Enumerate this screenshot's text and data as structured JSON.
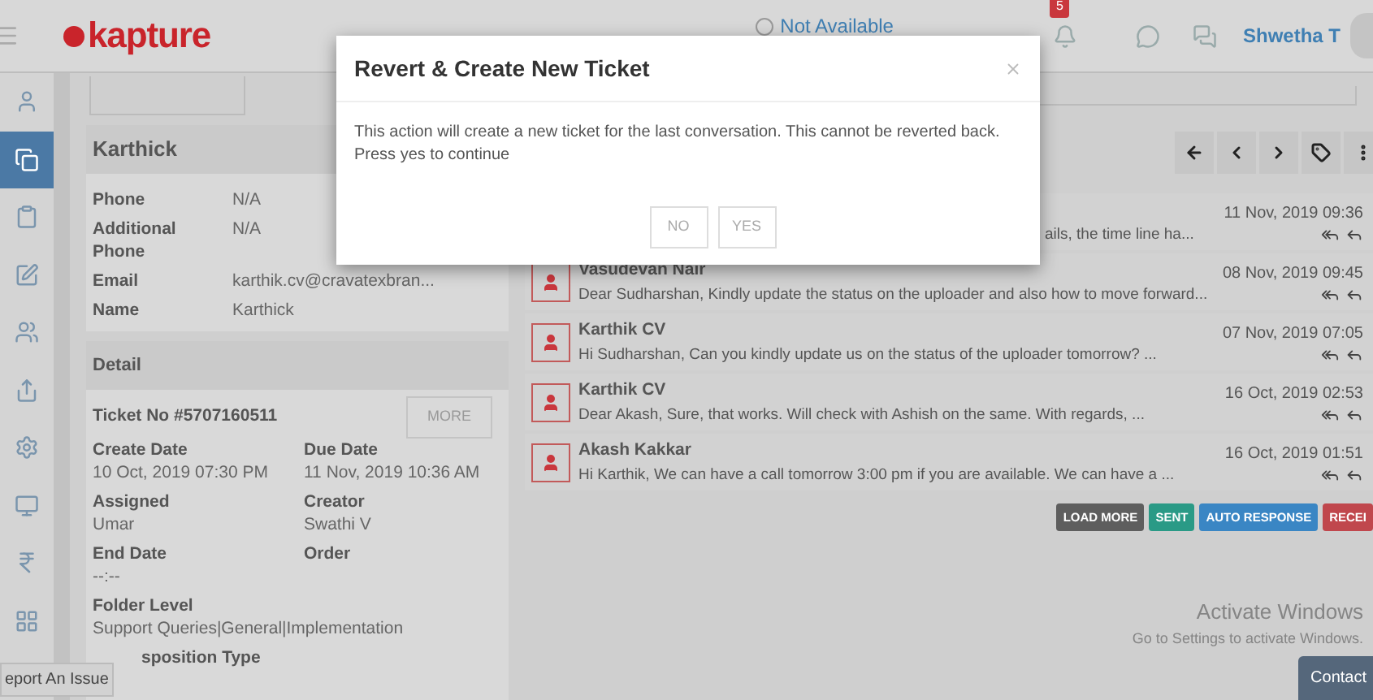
{
  "header": {
    "logo": "kapture",
    "status": {
      "label": "Not Available",
      "on": false
    },
    "notifications": {
      "count": "5"
    },
    "user": "Shwetha T"
  },
  "sidebar": {
    "items": [
      {
        "kind": "person",
        "selected": false
      },
      {
        "kind": "documents",
        "selected": true
      },
      {
        "kind": "clipboard",
        "selected": false
      },
      {
        "kind": "edit",
        "selected": false
      },
      {
        "kind": "contacts",
        "selected": false
      },
      {
        "kind": "share",
        "selected": false
      },
      {
        "kind": "settings",
        "selected": false
      },
      {
        "kind": "monitor",
        "selected": false
      },
      {
        "kind": "rupee",
        "selected": false
      },
      {
        "kind": "grid",
        "selected": false
      }
    ]
  },
  "customer": {
    "name": "Karthick",
    "fields": [
      {
        "label": "Phone",
        "value": "N/A"
      },
      {
        "label": "Additional Phone",
        "value": "N/A"
      },
      {
        "label": "Email",
        "value": "karthik.cv@cravatexbran..."
      },
      {
        "label": "Name",
        "value": "Karthick"
      }
    ]
  },
  "detail": {
    "title": "Detail",
    "ticket": "Ticket No #5707160511",
    "more": "MORE",
    "fields": [
      {
        "label": "Create Date",
        "value": "10 Oct, 2019 07:30 PM"
      },
      {
        "label": "Due Date",
        "value": "11 Nov, 2019 10:36 AM"
      },
      {
        "label": "Assigned",
        "value": "Umar"
      },
      {
        "label": "Creator",
        "value": "Swathi V"
      },
      {
        "label": "End Date",
        "value": "--:--"
      },
      {
        "label": "Order"
      }
    ],
    "folder": {
      "label": "Folder Level",
      "value": "Support Queries|General|Implementation"
    },
    "cut_label": "sposition Type"
  },
  "report_tab": "eport An Issue",
  "messages": [
    {
      "date": "11 Nov, 2019 09:36",
      "preview": "ails, the time line ha..."
    },
    {
      "sender": "Vasudevan Nair",
      "date": "08 Nov, 2019 09:45",
      "preview": "Dear Sudharshan,  Kindly update the status on the uploader and also how to move forward..."
    },
    {
      "sender": "Karthik CV",
      "date": "07 Nov, 2019 07:05",
      "preview": "Hi Sudharshan, Can you kindly update us on the status of the uploader tomorrow? ..."
    },
    {
      "sender": "Karthik CV",
      "date": "16 Oct, 2019 02:53",
      "preview": "Dear Akash, Sure, that works. Will check with Ashish on the same. With regards, ..."
    },
    {
      "sender": "Akash Kakkar",
      "date": "16 Oct, 2019 01:51",
      "preview": "Hi Karthik, We can have a call tomorrow 3:00 pm if you are available. We can have a ..."
    }
  ],
  "legend": [
    {
      "label": "LOAD MORE",
      "color": "#5e5e5e"
    },
    {
      "label": "SENT",
      "color": "#2a9a86"
    },
    {
      "label": "AUTO RESPONSE",
      "color": "#3a86c4"
    },
    {
      "label": "RECEI",
      "color": "#c0474d"
    }
  ],
  "windows_notice": {
    "title": "Activate Windows",
    "subtitle": "Go to Settings to activate Windows."
  },
  "contact_tab": "Contact",
  "modal": {
    "title": "Revert & Create New Ticket",
    "body": "This action will create a new ticket for the last conversation. This cannot be reverted back. Press yes to continue",
    "buttons": [
      "NO",
      "YES"
    ]
  }
}
